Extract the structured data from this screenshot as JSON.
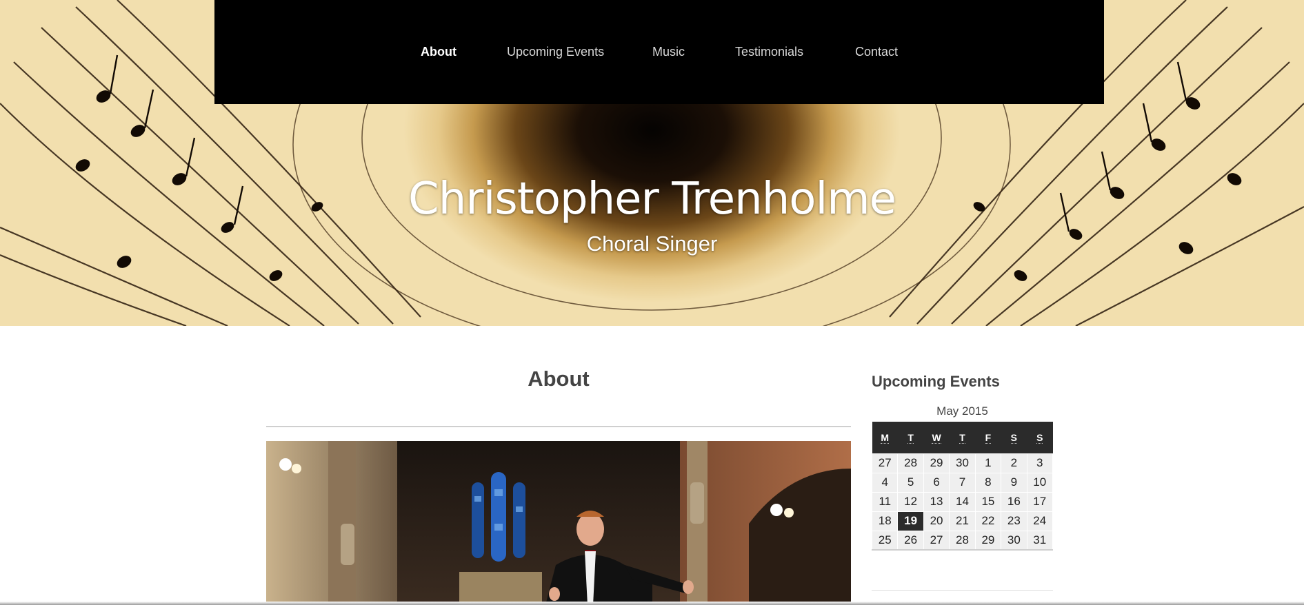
{
  "nav": {
    "items": [
      {
        "label": "About",
        "active": true
      },
      {
        "label": "Upcoming Events",
        "active": false
      },
      {
        "label": "Music",
        "active": false
      },
      {
        "label": "Testimonials",
        "active": false
      },
      {
        "label": "Contact",
        "active": false
      }
    ]
  },
  "hero": {
    "title": "Christopher Trenholme",
    "subtitle": "Choral Singer",
    "image_icon": "rolled-sheet-music-image"
  },
  "main": {
    "title": "About",
    "photo_icon": "singer-in-church-photo"
  },
  "sidebar": {
    "title": "Upcoming Events",
    "calendar": {
      "caption": "May 2015",
      "weekdays": [
        "M",
        "T",
        "W",
        "T",
        "F",
        "S",
        "S"
      ],
      "weeks": [
        [
          "27",
          "28",
          "29",
          "30",
          "1",
          "2",
          "3"
        ],
        [
          "4",
          "5",
          "6",
          "7",
          "8",
          "9",
          "10"
        ],
        [
          "11",
          "12",
          "13",
          "14",
          "15",
          "16",
          "17"
        ],
        [
          "18",
          "19",
          "20",
          "21",
          "22",
          "23",
          "24"
        ],
        [
          "25",
          "26",
          "27",
          "28",
          "29",
          "30",
          "31"
        ]
      ],
      "today": "19"
    }
  },
  "colors": {
    "nav_background": "#000000",
    "calendar_header": "#2b2b2b",
    "calendar_cell": "#efefef",
    "heading_text": "#444444"
  }
}
